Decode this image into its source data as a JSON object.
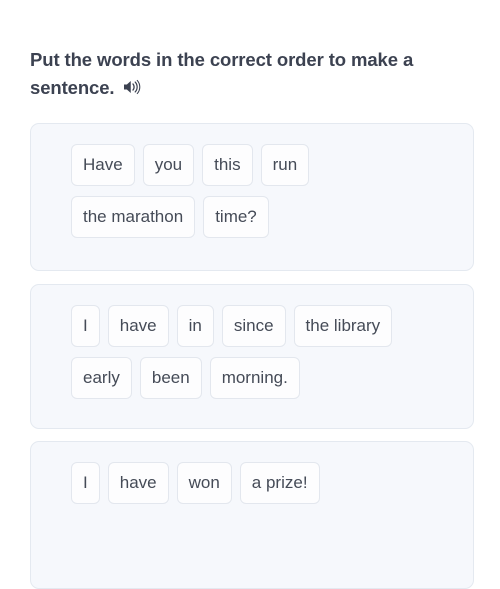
{
  "prompt": {
    "text": "Put the words in the correct order to make a sentence.",
    "audio_icon": "speaker-icon"
  },
  "colors": {
    "page_background": "#ffffff",
    "card_background": "#f6f8fc",
    "card_border": "#e4e9f0",
    "tile_background": "#fdfdfe",
    "tile_border": "#e3e7ee",
    "tile_text": "#454b57",
    "prompt_text": "#3c4251"
  },
  "questions": [
    {
      "id": "question-1",
      "rows": [
        [
          "Have",
          "you",
          "this",
          "run"
        ],
        [
          "the marathon",
          "time?"
        ]
      ]
    },
    {
      "id": "question-2",
      "rows": [
        [
          "I",
          "have",
          "in",
          "since",
          "the library"
        ],
        [
          "early",
          "been",
          "morning."
        ]
      ]
    },
    {
      "id": "question-3",
      "rows": [
        [
          "I",
          "have",
          "won",
          "a prize!"
        ]
      ]
    }
  ]
}
